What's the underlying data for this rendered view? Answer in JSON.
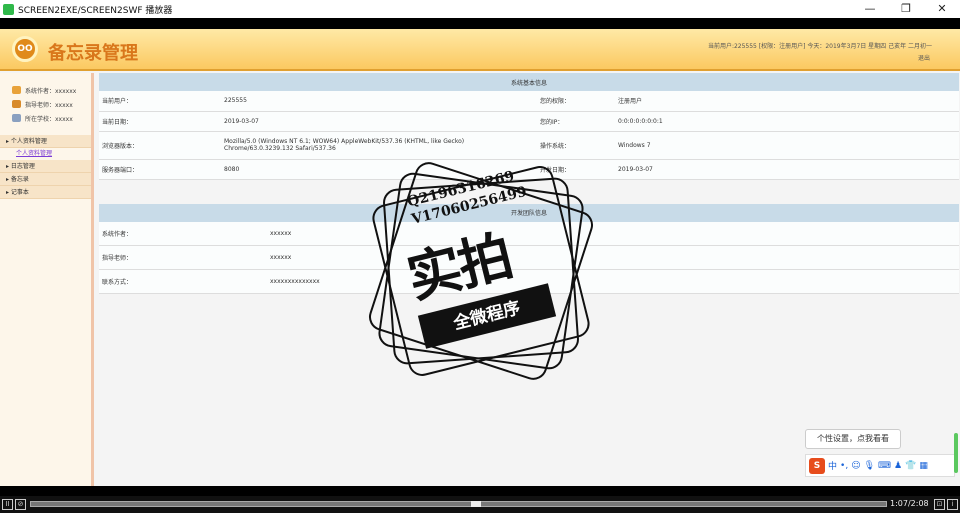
{
  "window": {
    "title": "SCREEN2EXE/SCREEN2SWF 播放器"
  },
  "header": {
    "title": "备忘录管理",
    "logo_text": "OO",
    "info": "当前用户:225555 [权限：注册用户] 今天：2019年3月7日 星期四 己亥年 二月初一",
    "logout": "退出"
  },
  "sidebar": {
    "info": [
      {
        "label": "系统作者：xxxxxx",
        "icon": "author-icon",
        "color": "#e8a23a"
      },
      {
        "label": "指导老师：xxxxx",
        "icon": "teacher-icon",
        "color": "#d88a2a"
      },
      {
        "label": "所在学校：xxxxx",
        "icon": "school-icon",
        "color": "#8aa0c0"
      }
    ],
    "menu": [
      {
        "label": "个人资料管理"
      },
      {
        "label": "个人资料管理"
      },
      {
        "label": "日志管理"
      },
      {
        "label": "备忘录"
      },
      {
        "label": "记事本"
      }
    ]
  },
  "system_info": {
    "title": "系统基本信息",
    "rows": [
      {
        "k1": "当前用户：",
        "v1": "225555",
        "k2": "您的权限：",
        "v2": "注册用户"
      },
      {
        "k1": "当前日期：",
        "v1": "2019-03-07",
        "k2": "您的IP：",
        "v2": "0:0:0:0:0:0:0:1"
      },
      {
        "k1": "浏览器版本：",
        "v1": "Mozilla/5.0 (Windows NT 6.1; WOW64) AppleWebKit/537.36 (KHTML, like Gecko) Chrome/63.0.3239.132 Safari/537.36",
        "k2": "操作系统：",
        "v2": "Windows 7"
      },
      {
        "k1": "服务器端口：",
        "v1": "8080",
        "k2": "开发日期：",
        "v2": "2019-03-07"
      }
    ]
  },
  "team_info": {
    "title": "开发团队信息",
    "rows": [
      {
        "k": "系统作者：",
        "v": "xxxxxx"
      },
      {
        "k": "指导老师：",
        "v": "xxxxxx"
      },
      {
        "k": "联系方式：",
        "v": "xxxxxxxxxxxxxx"
      }
    ]
  },
  "watermark": {
    "qq": "Q2196316269",
    "vx": "V17060256499",
    "big": "实拍",
    "band": "全微程序"
  },
  "ime": {
    "tip": "个性设置，点我看看",
    "logo": "S",
    "mode": "中"
  },
  "player": {
    "time": "1:07/2:08",
    "progress": 0.52,
    "play": "II",
    "fit": "⊡"
  }
}
